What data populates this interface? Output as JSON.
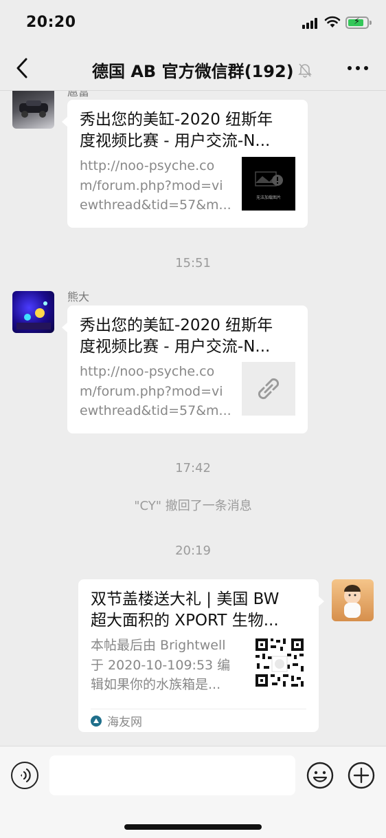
{
  "status_bar": {
    "time": "20:20"
  },
  "header": {
    "title": "德国 AB  官方微信群(192)",
    "back_icon": "chevron-left-icon",
    "mute_icon": "bell-off-icon",
    "more_icon": "more-dots-icon"
  },
  "messages": {
    "msg1": {
      "sender": "扈富",
      "title_line1": "秀出您的美缸-2020 纽斯年",
      "title_line2": "度视频比赛 - 用户交流-N...",
      "desc_line1": "http://noo-psyche.co",
      "desc_line2": "m/forum.php?mod=vi",
      "desc_line3": "ewthread&tid=57&m...",
      "thumb_caption": "无法加载图片"
    },
    "time1": "15:51",
    "msg2": {
      "sender": "熊大",
      "title_line1": "秀出您的美缸-2020 纽斯年",
      "title_line2": "度视频比赛 - 用户交流-N...",
      "desc_line1": "http://noo-psyche.co",
      "desc_line2": "m/forum.php?mod=vi",
      "desc_line3": "ewthread&tid=57&m...",
      "thumb_icon": "link-icon"
    },
    "time2": "17:42",
    "recall": "\"CY\" 撤回了一条消息",
    "time3": "20:19",
    "msg3": {
      "title_line1": "双节盖楼送大礼 | 美国 BW",
      "title_line2": "超大面积的 XPORT 生物...",
      "desc_line1": "本帖最后由 Brightwell",
      "desc_line2": "于 2020-10-109:53 编",
      "desc_line3": "辑如果你的水族箱是...",
      "source": "海友网",
      "thumb_icon": "qr-code-icon"
    }
  },
  "input_bar": {
    "voice_icon": "voice-icon",
    "emoji_icon": "emoji-icon",
    "plus_icon": "plus-circle-icon",
    "input_value": ""
  },
  "colors": {
    "background": "#ededed",
    "bubble": "#ffffff",
    "meta_text": "#9b9b9b",
    "battery_green": "#34c759"
  }
}
